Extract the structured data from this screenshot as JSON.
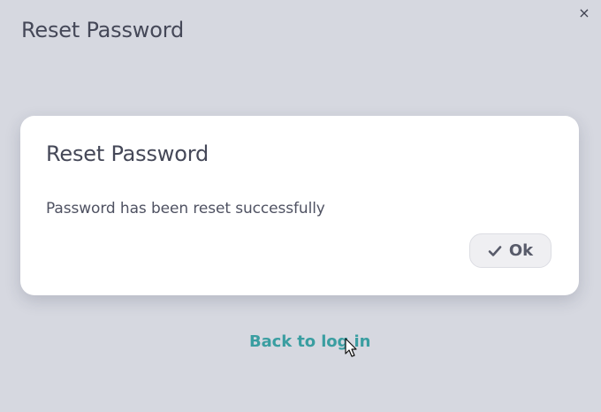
{
  "window": {
    "title": "Reset Password",
    "close_icon": "×"
  },
  "dialog": {
    "title": "Reset Password",
    "message": "Password has been reset successfully",
    "ok_label": "Ok",
    "ok_icon": "check-icon"
  },
  "footer": {
    "back_link": "Back to log in"
  },
  "colors": {
    "background": "#d6d8e0",
    "dialog_bg": "#ffffff",
    "link": "#3a9ea1",
    "text": "#454858"
  }
}
